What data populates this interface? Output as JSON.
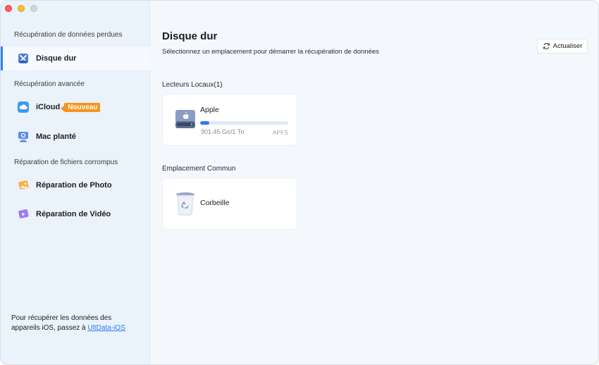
{
  "sidebar": {
    "section_lost": "Récupération de données perdues",
    "section_advanced": "Récupération avancée",
    "section_repair": "Réparation de fichiers corrompus",
    "items": [
      {
        "label": "Disque dur",
        "icon": "hard-drive-tools-icon"
      },
      {
        "label": "iCloud",
        "icon": "icloud-icon",
        "badge": "Nouveau"
      },
      {
        "label": "Mac planté",
        "icon": "crashed-mac-icon"
      },
      {
        "label": "Réparation de Photo",
        "icon": "photo-repair-icon"
      },
      {
        "label": "Réparation de Vidéo",
        "icon": "video-repair-icon"
      }
    ],
    "footnote_text": "Pour récupérer les données des appareils iOS, passez à ",
    "footnote_link": "UltData-iOS"
  },
  "main": {
    "title": "Disque dur",
    "subtitle": "Sélectionnez un emplacement pour démarrer la récupération de données",
    "refresh_label": "Actualiser",
    "local_drives_title": "Lecteurs Locaux(1)",
    "common_title": "Emplacement Commun",
    "drive": {
      "name": "Apple",
      "size": "901.45 Go/1 To",
      "filesystem": "APFS",
      "used_fraction": 0.1
    },
    "trash": {
      "name": "Corbeille"
    }
  },
  "colors": {
    "accent": "#2f7bf5",
    "badge": "#f7931e",
    "sidebar_bg": "#eaf2fb",
    "main_bg": "#f4f7fc"
  }
}
